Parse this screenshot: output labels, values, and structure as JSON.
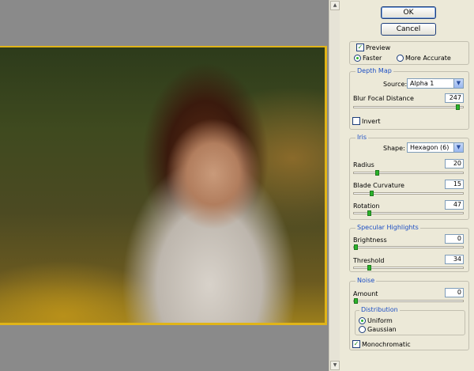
{
  "dialog": {
    "ok_label": "OK",
    "cancel_label": "Cancel"
  },
  "preview_opts": {
    "preview_label": "Preview",
    "preview_checked": true,
    "faster_label": "Faster",
    "more_accurate_label": "More Accurate",
    "selected": "Faster"
  },
  "depth_map": {
    "title": "Depth Map",
    "source_label": "Source:",
    "source_value": "Alpha 1",
    "blur_label": "Blur Focal Distance",
    "blur_value": "247",
    "blur_fraction": 0.97,
    "invert_label": "Invert",
    "invert_checked": false
  },
  "iris": {
    "title": "Iris",
    "shape_label": "Shape:",
    "shape_value": "Hexagon (6)",
    "radius_label": "Radius",
    "radius_value": "20",
    "radius_fraction": 0.2,
    "blade_label": "Blade Curvature",
    "blade_value": "15",
    "blade_fraction": 0.15,
    "rotation_label": "Rotation",
    "rotation_value": "47",
    "rotation_fraction": 0.13
  },
  "specular": {
    "title": "Specular Highlights",
    "brightness_label": "Brightness",
    "brightness_value": "0",
    "brightness_fraction": 0.0,
    "threshold_label": "Threshold",
    "threshold_value": "34",
    "threshold_fraction": 0.13
  },
  "noise": {
    "title": "Noise",
    "amount_label": "Amount",
    "amount_value": "0",
    "amount_fraction": 0.0,
    "distribution_title": "Distribution",
    "uniform_label": "Uniform",
    "gaussian_label": "Gaussian",
    "selected": "Uniform",
    "mono_label": "Monochromatic",
    "mono_checked": true
  },
  "colors": {
    "accent": "#1d4fc4",
    "slider_thumb": "#2bb32a",
    "image_border": "#e0b418"
  }
}
